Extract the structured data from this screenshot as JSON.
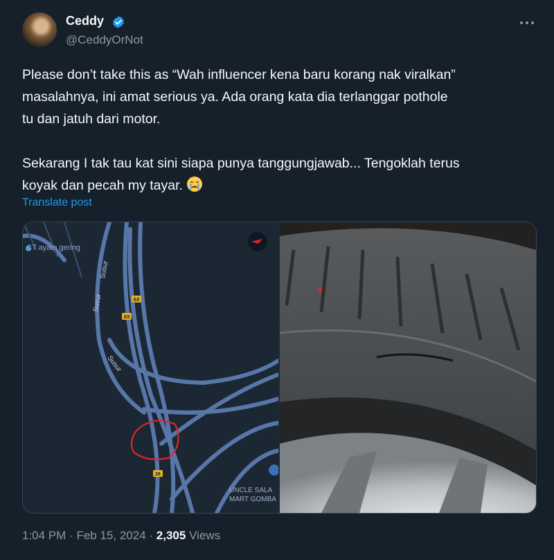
{
  "author": {
    "name": "Ceddy",
    "handle": "@CeddyOrNot",
    "verified": true
  },
  "tweet": {
    "text_line1": "Please don’t take this as “Wah influencer kena baru korang nak viralkan”",
    "text_line2": "masalahnya, ini amat serious ya. Ada orang kata dia terlanggar pothole",
    "text_line3": "tu dan jatuh dari motor.",
    "text_line4": "Sekarang I tak tau kat sini siapa punya tanggungjawab... Tengoklah terus",
    "text_line5": "koyak dan pecah my tayar.",
    "emoji": "crying-face-emoji",
    "translate_label": "Translate post"
  },
  "map": {
    "poi_label": "CT ayam gering",
    "road_label_1": "Susur",
    "road_label_2": "Susur",
    "road_label_3": "Susur",
    "shield_1": "E8",
    "shield_2": "E8",
    "shield_3": "28",
    "place_label_1": "UNCLE SALA",
    "place_label_2": "MART GOMBA"
  },
  "footer": {
    "time": "1:04 PM",
    "separator": "·",
    "date": "Feb 15, 2024",
    "views_count": "2,305",
    "views_label": "Views"
  },
  "colors": {
    "background": "#15202b",
    "accent": "#1d9bf0",
    "muted": "#8b98a5",
    "highlight_circle": "#e0262a"
  }
}
